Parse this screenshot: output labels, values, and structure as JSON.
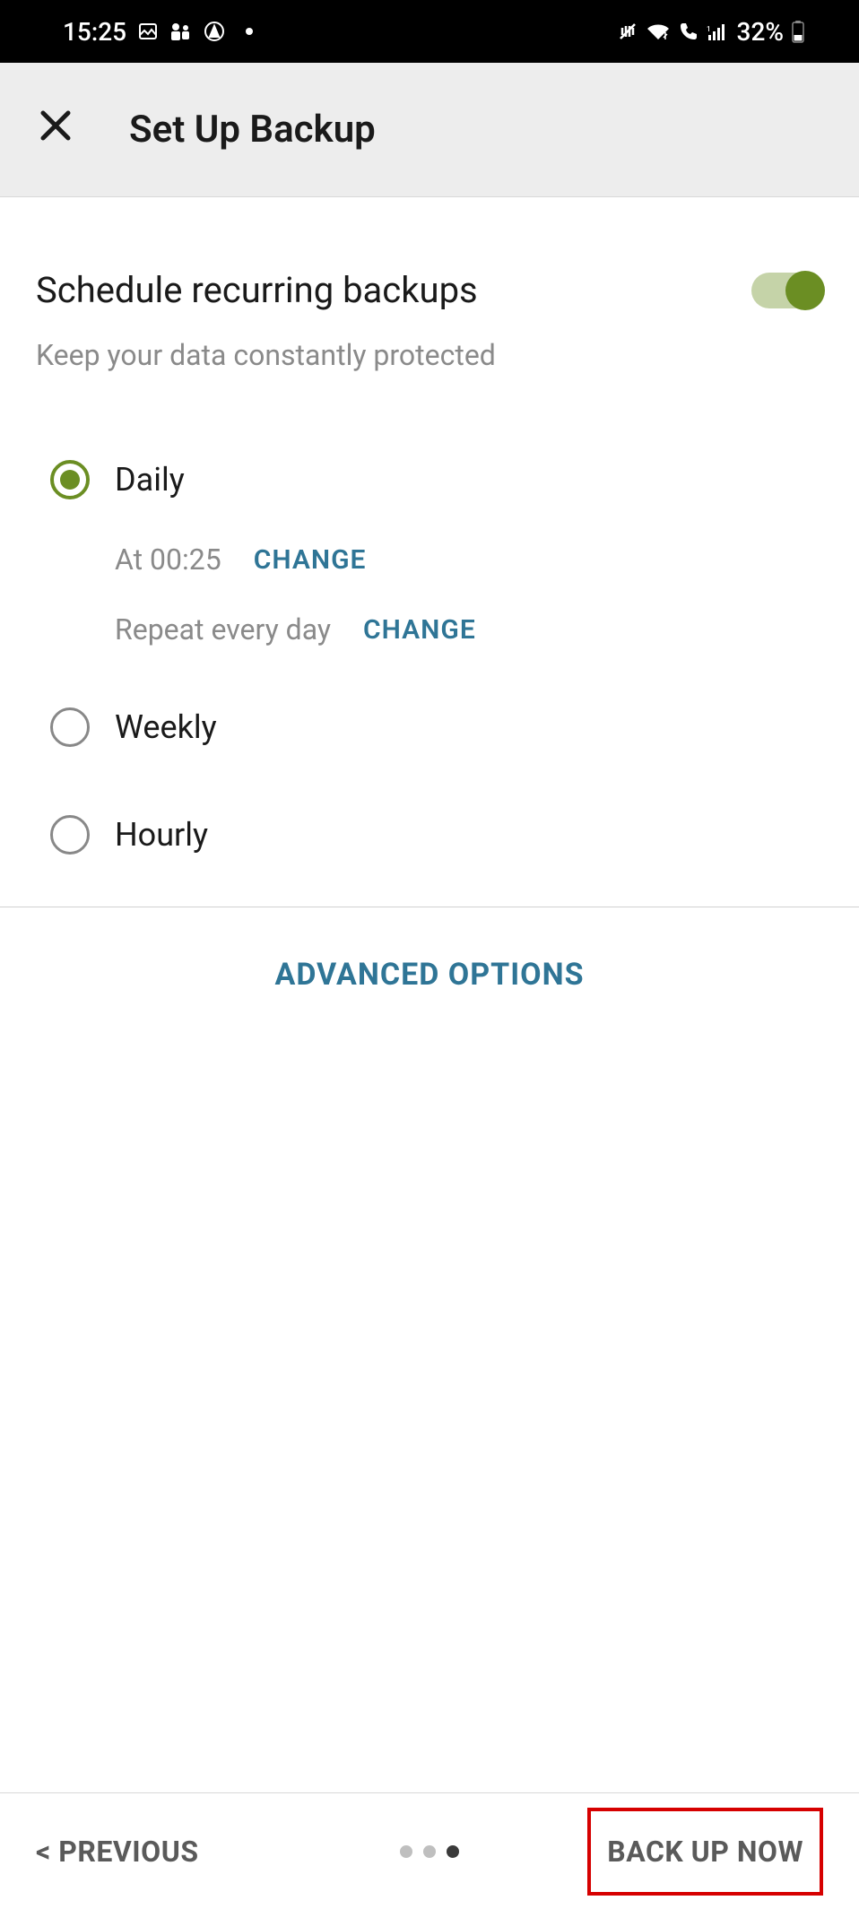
{
  "status_bar": {
    "time": "15:25",
    "battery_percent": "32%"
  },
  "header": {
    "title": "Set Up Backup"
  },
  "schedule": {
    "title": "Schedule recurring backups",
    "subtitle": "Keep your data constantly protected",
    "toggle_on": true
  },
  "options": {
    "daily": {
      "label": "Daily",
      "selected": true,
      "time_text": "At 00:25",
      "time_change": "CHANGE",
      "repeat_text": "Repeat every day",
      "repeat_change": "CHANGE"
    },
    "weekly": {
      "label": "Weekly",
      "selected": false
    },
    "hourly": {
      "label": "Hourly",
      "selected": false
    }
  },
  "advanced_label": "ADVANCED OPTIONS",
  "footer": {
    "previous": "< PREVIOUS",
    "backup_now": "BACK UP NOW",
    "page_count": 3,
    "page_active": 3
  }
}
